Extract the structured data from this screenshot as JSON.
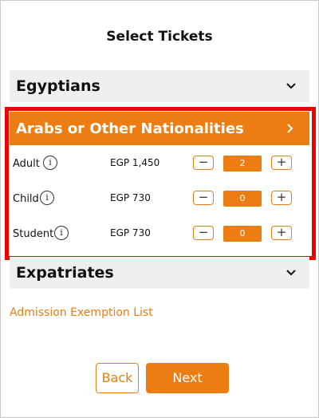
{
  "page": {
    "title": "Select Tickets"
  },
  "accordion": {
    "egyptians": {
      "label": "Egyptians",
      "icon": "chevron-down-icon"
    },
    "arabs": {
      "label": "Arabs or Other Nationalities",
      "icon": "chevron-right-icon"
    },
    "expatriates": {
      "label": "Expatriates",
      "icon": "chevron-down-icon"
    }
  },
  "tickets": [
    {
      "label": "Adult",
      "price": "EGP 1,450",
      "quantity": "2",
      "minus": "−",
      "plus": "+",
      "info": "i"
    },
    {
      "label": "Child",
      "price": "EGP 730",
      "quantity": "0",
      "minus": "−",
      "plus": "+",
      "info": "i"
    },
    {
      "label": "Student",
      "price": "EGP 730",
      "quantity": "0",
      "minus": "−",
      "plus": "+",
      "info": "i"
    }
  ],
  "links": {
    "exemption": "Admission Exemption List"
  },
  "actions": {
    "back": "Back",
    "next": "Next"
  },
  "colors": {
    "accent": "#ec7d12",
    "highlight": "#f00000",
    "header_bg": "#efefef"
  }
}
